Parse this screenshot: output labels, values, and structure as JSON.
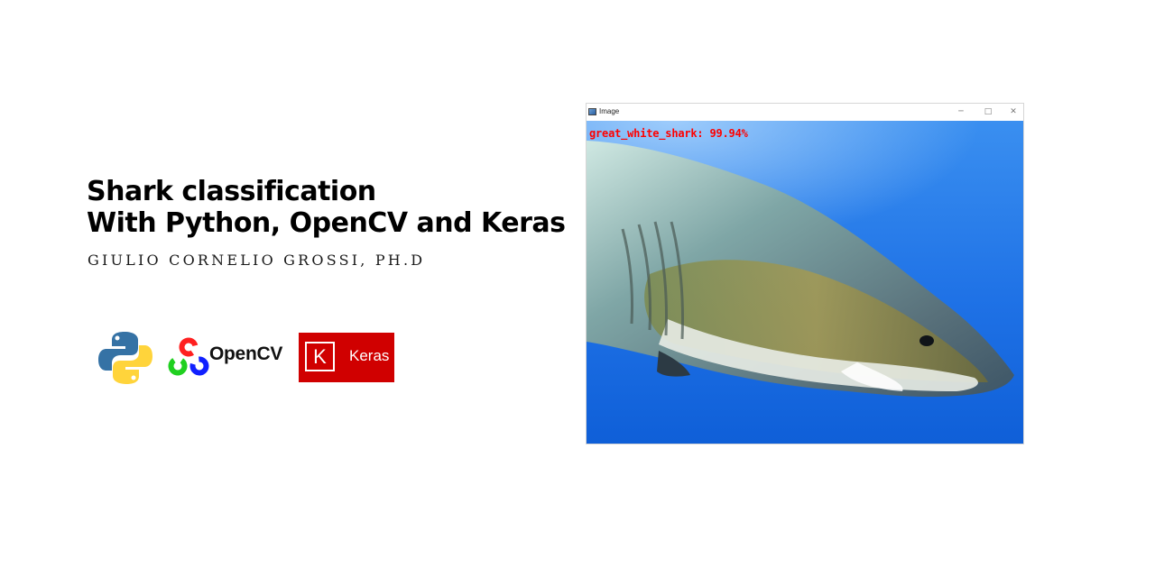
{
  "header": {
    "title_line1": "Shark classification",
    "title_line2": "With Python, OpenCV and Keras",
    "author": "GIULIO CORNELIO GROSSI, PH.D"
  },
  "logos": {
    "python_icon": "python-logo",
    "opencv_icon": "opencv-logo",
    "opencv_label": "OpenCV",
    "keras_icon_letter": "K",
    "keras_label": "Keras",
    "keras_color": "#d00000"
  },
  "window": {
    "title": "Image",
    "minimize_glyph": "─",
    "maximize_glyph": "□",
    "close_glyph": "✕",
    "prediction_label": "great_white_shark:  99.94%",
    "prediction_color": "#ff0000",
    "water_color": "#1f6fe0"
  }
}
